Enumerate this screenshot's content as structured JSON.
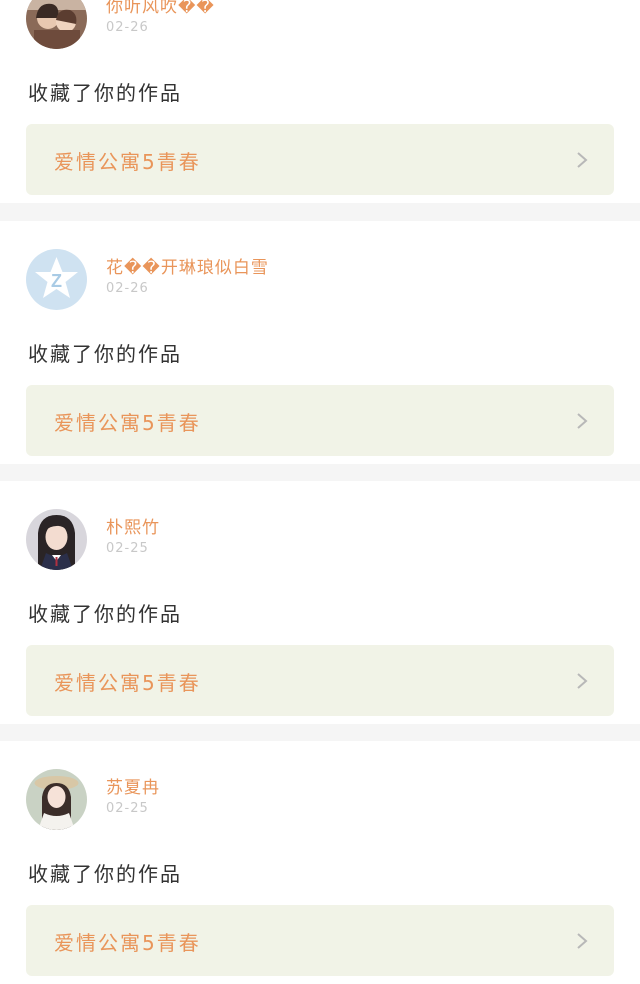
{
  "notifications": [
    {
      "username": "你听风吹��",
      "date": "02-26",
      "action": "收藏了你的作品",
      "work_title": "爱情公寓5青春",
      "avatar": "photo-couple"
    },
    {
      "username": "花��开琳琅似白雪",
      "date": "02-26",
      "action": "收藏了你的作品",
      "work_title": "爱情公寓5青春",
      "avatar": "qzone-default-avatar",
      "avatar_badge": "Z"
    },
    {
      "username": "朴熙竹",
      "date": "02-25",
      "action": "收藏了你的作品",
      "work_title": "爱情公寓5青春",
      "avatar": "photo-girl-school-uniform"
    },
    {
      "username": "苏夏冉",
      "date": "02-25",
      "action": "收藏了你的作品",
      "work_title": "爱情公寓5青春",
      "avatar": "photo-girl-white-dress"
    }
  ],
  "colors": {
    "accent": "#e9955a",
    "card_link_bg": "#f1f3e7",
    "page_bg": "#f5f5f5"
  }
}
